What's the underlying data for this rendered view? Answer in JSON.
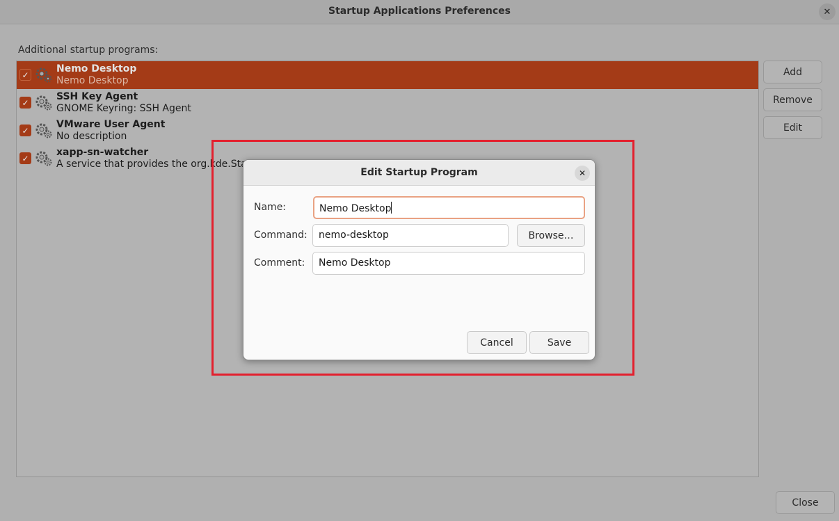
{
  "window": {
    "title": "Startup Applications Preferences",
    "close_icon": "close-icon"
  },
  "list": {
    "label": "Additional startup programs:",
    "items": [
      {
        "name": "Nemo Desktop",
        "description": "Nemo Desktop",
        "enabled": true,
        "selected": true,
        "icon": "gear-icon"
      },
      {
        "name": "SSH Key Agent",
        "description": "GNOME Keyring: SSH Agent",
        "enabled": true,
        "selected": false,
        "icon": "gear-icon"
      },
      {
        "name": "VMware User Agent",
        "description": "No description",
        "enabled": true,
        "selected": false,
        "icon": "gear-icon"
      },
      {
        "name": "xapp-sn-watcher",
        "description": "A service that provides the org.kde.StatusNotifierWatcher interface",
        "enabled": true,
        "selected": false,
        "icon": "gear-icon"
      }
    ]
  },
  "buttons": {
    "add": "Add",
    "remove": "Remove",
    "edit": "Edit",
    "close": "Close"
  },
  "dialog": {
    "title": "Edit Startup Program",
    "name_label": "Name:",
    "name_value": "Nemo Desktop",
    "command_label": "Command:",
    "command_value": "nemo-desktop",
    "browse_label": "Browse…",
    "comment_label": "Comment:",
    "comment_value": "Nemo Desktop",
    "cancel_label": "Cancel",
    "save_label": "Save"
  },
  "colors": {
    "accent": "#a43b17",
    "highlight_box": "#e3202e",
    "focus_border": "#e9a283"
  }
}
